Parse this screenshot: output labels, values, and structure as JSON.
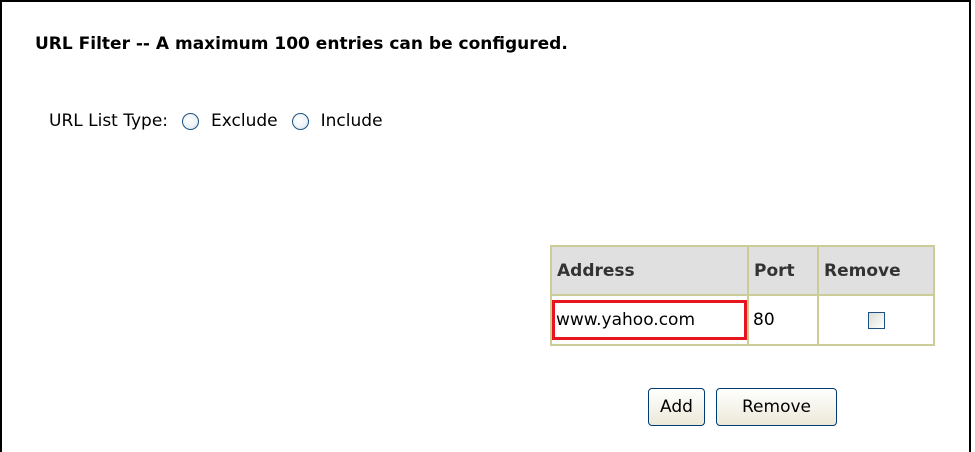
{
  "page": {
    "title": "URL Filter -- A maximum 100 entries can be configured."
  },
  "list_type": {
    "label": "URL List Type:",
    "options": [
      {
        "label": "Exclude",
        "selected": false
      },
      {
        "label": "Include",
        "selected": false
      }
    ]
  },
  "table": {
    "headers": [
      "Address",
      "Port",
      "Remove"
    ],
    "rows": [
      {
        "address": "www.yahoo.com",
        "port": "80",
        "remove": false,
        "highlighted": true
      }
    ]
  },
  "buttons": {
    "add_label": "Add",
    "remove_label": "Remove"
  },
  "colors": {
    "highlight": "#e8141e",
    "table_border": "#cccc99",
    "header_bg": "#e0e0e0"
  }
}
